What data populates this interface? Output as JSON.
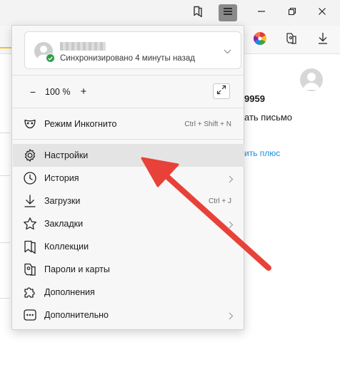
{
  "titlebar": {
    "bookmark_icon": "bookmarks-panel-icon",
    "menu_icon": "hamburger-menu-icon",
    "minimize_icon": "minimize-icon",
    "restore_icon": "restore-icon",
    "close_icon": "close-icon"
  },
  "toolbar": {
    "color_icon": "color-wheel-icon",
    "passwords_icon": "passwords-icon",
    "download_icon": "download-icon"
  },
  "background": {
    "number_fragment": "9959",
    "write_letter_fragment": "ать письмо",
    "plus_link_fragment": "ить плюс"
  },
  "menu": {
    "sync": {
      "status": "Синхронизировано 4 минуты назад"
    },
    "zoom": {
      "minus": "−",
      "value": "100 %",
      "plus": "+"
    },
    "incognito": {
      "label": "Режим Инкогнито",
      "shortcut": "Ctrl + Shift + N"
    },
    "items": [
      {
        "label": "Настройки",
        "icon": "gear-icon",
        "shortcut": "",
        "has_submenu": false,
        "hover": true
      },
      {
        "label": "История",
        "icon": "history-clock-icon",
        "shortcut": "",
        "has_submenu": true,
        "hover": false
      },
      {
        "label": "Загрузки",
        "icon": "download-icon",
        "shortcut": "Ctrl + J",
        "has_submenu": false,
        "hover": false
      },
      {
        "label": "Закладки",
        "icon": "star-icon",
        "shortcut": "",
        "has_submenu": true,
        "hover": false
      },
      {
        "label": "Коллекции",
        "icon": "collections-icon",
        "shortcut": "",
        "has_submenu": false,
        "hover": false
      },
      {
        "label": "Пароли и карты",
        "icon": "key-card-icon",
        "shortcut": "",
        "has_submenu": false,
        "hover": false
      },
      {
        "label": "Дополнения",
        "icon": "puzzle-icon",
        "shortcut": "",
        "has_submenu": false,
        "hover": false
      },
      {
        "label": "Дополнительно",
        "icon": "more-dots-icon",
        "shortcut": "",
        "has_submenu": true,
        "hover": false
      }
    ]
  },
  "colors": {
    "annotation_arrow": "#e8413a",
    "sync_check": "#2e9e4a",
    "link": "#1a8fe0",
    "hover_bg": "#e4e4e4",
    "accent_yellow": "#f3c623"
  }
}
